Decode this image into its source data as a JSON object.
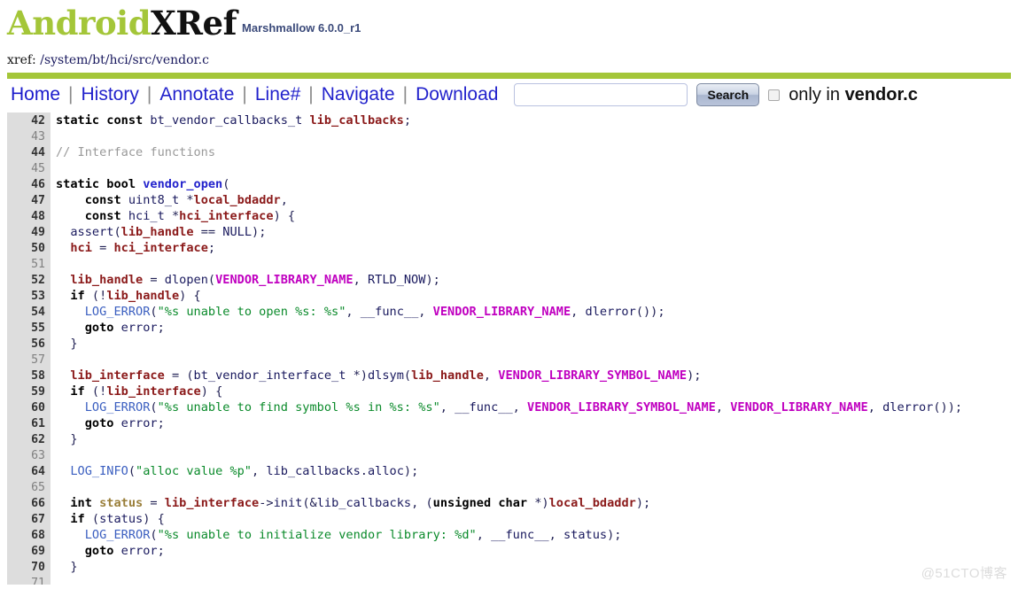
{
  "header": {
    "logo_android": "Android",
    "logo_xref": "XRef",
    "version": "Marshmallow 6.0.0_r1"
  },
  "xref": {
    "label": "xref:",
    "path": "/system/bt/hci/src/vendor.c"
  },
  "menu": {
    "items": [
      {
        "label": "Home",
        "name": "nav-home"
      },
      {
        "label": "History",
        "name": "nav-history"
      },
      {
        "label": "Annotate",
        "name": "nav-annotate"
      },
      {
        "label": "Line#",
        "name": "nav-line-number"
      },
      {
        "label": "Navigate",
        "name": "nav-navigate"
      },
      {
        "label": "Download",
        "name": "nav-download"
      }
    ],
    "separator": "|",
    "search_value": "",
    "search_placeholder": "",
    "search_button": "Search",
    "only_in_prefix": "only in ",
    "only_in_file": "vendor.c",
    "only_in_checked": false
  },
  "colors": {
    "brand_green": "#a4c639",
    "link_blue": "#2222cc",
    "gutter_gray": "#dddddd",
    "string_green": "#0a8a2a",
    "macro_magenta": "#c000c0",
    "variable_maroon": "#8b1a1a"
  },
  "watermark": "@51CTO博客",
  "code": {
    "first_line": 42,
    "last_line": 71,
    "lines": [
      {
        "n": 42,
        "tokens": [
          {
            "t": "static const ",
            "c": "kw"
          },
          {
            "t": "bt_vendor_callbacks_t ",
            "c": "typ"
          },
          {
            "t": "lib_callbacks",
            "c": "var"
          },
          {
            "t": ";",
            "c": "pln"
          }
        ]
      },
      {
        "n": 43,
        "tokens": []
      },
      {
        "n": 44,
        "tokens": [
          {
            "t": "// Interface functions",
            "c": "cmt"
          }
        ]
      },
      {
        "n": 45,
        "tokens": []
      },
      {
        "n": 46,
        "tokens": [
          {
            "t": "static bool ",
            "c": "kw"
          },
          {
            "t": "vendor_open",
            "c": "fn"
          },
          {
            "t": "(",
            "c": "pln"
          }
        ]
      },
      {
        "n": 47,
        "tokens": [
          {
            "t": "    ",
            "c": "pln"
          },
          {
            "t": "const ",
            "c": "kw"
          },
          {
            "t": "uint8_t ",
            "c": "typ"
          },
          {
            "t": "*",
            "c": "pln"
          },
          {
            "t": "local_bdaddr",
            "c": "var"
          },
          {
            "t": ",",
            "c": "pln"
          }
        ]
      },
      {
        "n": 48,
        "tokens": [
          {
            "t": "    ",
            "c": "pln"
          },
          {
            "t": "const ",
            "c": "kw"
          },
          {
            "t": "hci_t ",
            "c": "typ"
          },
          {
            "t": "*",
            "c": "pln"
          },
          {
            "t": "hci_interface",
            "c": "var"
          },
          {
            "t": ") {",
            "c": "pln"
          }
        ]
      },
      {
        "n": 49,
        "tokens": [
          {
            "t": "  assert",
            "c": "typ"
          },
          {
            "t": "(",
            "c": "pln"
          },
          {
            "t": "lib_handle",
            "c": "var"
          },
          {
            "t": " == ",
            "c": "pln"
          },
          {
            "t": "NULL",
            "c": "typ"
          },
          {
            "t": ");",
            "c": "pln"
          }
        ]
      },
      {
        "n": 50,
        "tokens": [
          {
            "t": "  ",
            "c": "pln"
          },
          {
            "t": "hci",
            "c": "var"
          },
          {
            "t": " = ",
            "c": "pln"
          },
          {
            "t": "hci_interface",
            "c": "var"
          },
          {
            "t": ";",
            "c": "pln"
          }
        ]
      },
      {
        "n": 51,
        "tokens": []
      },
      {
        "n": 52,
        "tokens": [
          {
            "t": "  ",
            "c": "pln"
          },
          {
            "t": "lib_handle",
            "c": "var"
          },
          {
            "t": " = ",
            "c": "pln"
          },
          {
            "t": "dlopen",
            "c": "typ"
          },
          {
            "t": "(",
            "c": "pln"
          },
          {
            "t": "VENDOR_LIBRARY_NAME",
            "c": "mac"
          },
          {
            "t": ", ",
            "c": "pln"
          },
          {
            "t": "RTLD_NOW",
            "c": "typ"
          },
          {
            "t": ");",
            "c": "pln"
          }
        ]
      },
      {
        "n": 53,
        "tokens": [
          {
            "t": "  ",
            "c": "pln"
          },
          {
            "t": "if",
            "c": "kw"
          },
          {
            "t": " (!",
            "c": "pln"
          },
          {
            "t": "lib_handle",
            "c": "var"
          },
          {
            "t": ") {",
            "c": "pln"
          }
        ]
      },
      {
        "n": 54,
        "tokens": [
          {
            "t": "    ",
            "c": "pln"
          },
          {
            "t": "LOG_ERROR",
            "c": "call"
          },
          {
            "t": "(",
            "c": "pln"
          },
          {
            "t": "\"%s unable to open %s: %s\"",
            "c": "str"
          },
          {
            "t": ", ",
            "c": "pln"
          },
          {
            "t": "__func__",
            "c": "dblu"
          },
          {
            "t": ", ",
            "c": "pln"
          },
          {
            "t": "VENDOR_LIBRARY_NAME",
            "c": "mac"
          },
          {
            "t": ", ",
            "c": "pln"
          },
          {
            "t": "dlerror",
            "c": "typ"
          },
          {
            "t": "());",
            "c": "pln"
          }
        ]
      },
      {
        "n": 55,
        "tokens": [
          {
            "t": "    ",
            "c": "pln"
          },
          {
            "t": "goto ",
            "c": "kw"
          },
          {
            "t": "error",
            "c": "typ"
          },
          {
            "t": ";",
            "c": "pln"
          }
        ]
      },
      {
        "n": 56,
        "tokens": [
          {
            "t": "  }",
            "c": "pln"
          }
        ]
      },
      {
        "n": 57,
        "tokens": []
      },
      {
        "n": 58,
        "tokens": [
          {
            "t": "  ",
            "c": "pln"
          },
          {
            "t": "lib_interface",
            "c": "var"
          },
          {
            "t": " = (",
            "c": "pln"
          },
          {
            "t": "bt_vendor_interface_t ",
            "c": "typ"
          },
          {
            "t": "*)",
            "c": "pln"
          },
          {
            "t": "dlsym",
            "c": "typ"
          },
          {
            "t": "(",
            "c": "pln"
          },
          {
            "t": "lib_handle",
            "c": "var"
          },
          {
            "t": ", ",
            "c": "pln"
          },
          {
            "t": "VENDOR_LIBRARY_SYMBOL_NAME",
            "c": "mac"
          },
          {
            "t": ");",
            "c": "pln"
          }
        ]
      },
      {
        "n": 59,
        "tokens": [
          {
            "t": "  ",
            "c": "pln"
          },
          {
            "t": "if",
            "c": "kw"
          },
          {
            "t": " (!",
            "c": "pln"
          },
          {
            "t": "lib_interface",
            "c": "var"
          },
          {
            "t": ") {",
            "c": "pln"
          }
        ]
      },
      {
        "n": 60,
        "tokens": [
          {
            "t": "    ",
            "c": "pln"
          },
          {
            "t": "LOG_ERROR",
            "c": "call"
          },
          {
            "t": "(",
            "c": "pln"
          },
          {
            "t": "\"%s unable to find symbol %s in %s: %s\"",
            "c": "str"
          },
          {
            "t": ", ",
            "c": "pln"
          },
          {
            "t": "__func__",
            "c": "dblu"
          },
          {
            "t": ", ",
            "c": "pln"
          },
          {
            "t": "VENDOR_LIBRARY_SYMBOL_NAME",
            "c": "mac"
          },
          {
            "t": ", ",
            "c": "pln"
          },
          {
            "t": "VENDOR_LIBRARY_NAME",
            "c": "mac"
          },
          {
            "t": ", ",
            "c": "pln"
          },
          {
            "t": "dlerror",
            "c": "typ"
          },
          {
            "t": "());",
            "c": "pln"
          }
        ]
      },
      {
        "n": 61,
        "tokens": [
          {
            "t": "    ",
            "c": "pln"
          },
          {
            "t": "goto ",
            "c": "kw"
          },
          {
            "t": "error",
            "c": "typ"
          },
          {
            "t": ";",
            "c": "pln"
          }
        ]
      },
      {
        "n": 62,
        "tokens": [
          {
            "t": "  }",
            "c": "pln"
          }
        ]
      },
      {
        "n": 63,
        "tokens": []
      },
      {
        "n": 64,
        "tokens": [
          {
            "t": "  ",
            "c": "pln"
          },
          {
            "t": "LOG_INFO",
            "c": "call"
          },
          {
            "t": "(",
            "c": "pln"
          },
          {
            "t": "\"alloc value %p\"",
            "c": "str"
          },
          {
            "t": ", ",
            "c": "pln"
          },
          {
            "t": "lib_callbacks",
            "c": "typ"
          },
          {
            "t": ".",
            "c": "pln"
          },
          {
            "t": "alloc",
            "c": "typ"
          },
          {
            "t": ");",
            "c": "pln"
          }
        ]
      },
      {
        "n": 65,
        "tokens": []
      },
      {
        "n": 66,
        "tokens": [
          {
            "t": "  ",
            "c": "pln"
          },
          {
            "t": "int ",
            "c": "kw"
          },
          {
            "t": "status",
            "c": "brn"
          },
          {
            "t": " = ",
            "c": "pln"
          },
          {
            "t": "lib_interface",
            "c": "var"
          },
          {
            "t": "->",
            "c": "pln"
          },
          {
            "t": "init",
            "c": "typ"
          },
          {
            "t": "(&",
            "c": "pln"
          },
          {
            "t": "lib_callbacks",
            "c": "typ"
          },
          {
            "t": ", (",
            "c": "pln"
          },
          {
            "t": "unsigned char ",
            "c": "kw"
          },
          {
            "t": "*)",
            "c": "pln"
          },
          {
            "t": "local_bdaddr",
            "c": "var"
          },
          {
            "t": ");",
            "c": "pln"
          }
        ]
      },
      {
        "n": 67,
        "tokens": [
          {
            "t": "  ",
            "c": "pln"
          },
          {
            "t": "if",
            "c": "kw"
          },
          {
            "t": " (",
            "c": "pln"
          },
          {
            "t": "status",
            "c": "typ"
          },
          {
            "t": ") {",
            "c": "pln"
          }
        ]
      },
      {
        "n": 68,
        "tokens": [
          {
            "t": "    ",
            "c": "pln"
          },
          {
            "t": "LOG_ERROR",
            "c": "call"
          },
          {
            "t": "(",
            "c": "pln"
          },
          {
            "t": "\"%s unable to initialize vendor library: %d\"",
            "c": "str"
          },
          {
            "t": ", ",
            "c": "pln"
          },
          {
            "t": "__func__",
            "c": "dblu"
          },
          {
            "t": ", ",
            "c": "pln"
          },
          {
            "t": "status",
            "c": "typ"
          },
          {
            "t": ");",
            "c": "pln"
          }
        ]
      },
      {
        "n": 69,
        "tokens": [
          {
            "t": "    ",
            "c": "pln"
          },
          {
            "t": "goto ",
            "c": "kw"
          },
          {
            "t": "error",
            "c": "typ"
          },
          {
            "t": ";",
            "c": "pln"
          }
        ]
      },
      {
        "n": 70,
        "tokens": [
          {
            "t": "  }",
            "c": "pln"
          }
        ]
      },
      {
        "n": 71,
        "tokens": []
      }
    ]
  }
}
